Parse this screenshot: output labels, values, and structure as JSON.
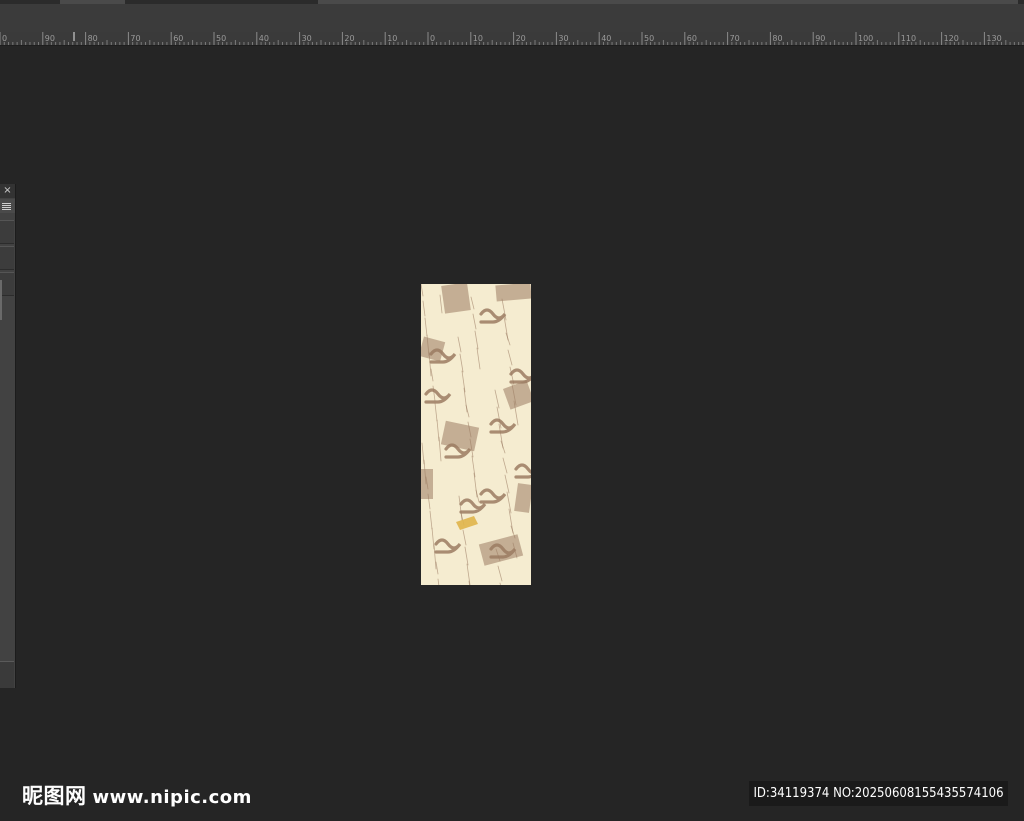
{
  "ruler": {
    "labels": [
      "0",
      "90",
      "80",
      "70",
      "60",
      "50",
      "40",
      "30",
      "20",
      "10",
      "0",
      "10",
      "20",
      "30",
      "40",
      "50",
      "60",
      "70",
      "80",
      "90",
      "100",
      "110",
      "120",
      "130"
    ]
  },
  "panel": {
    "close_glyph": "×"
  },
  "document": {
    "background_color": "#f5ecd0",
    "pattern_color": "#9b7b62",
    "accent_color": "#e0b54a"
  },
  "watermark": {
    "site_name": "昵图网",
    "url": "www.nipic.com",
    "id_text": "ID:34119374 NO:20250608155435574106"
  }
}
